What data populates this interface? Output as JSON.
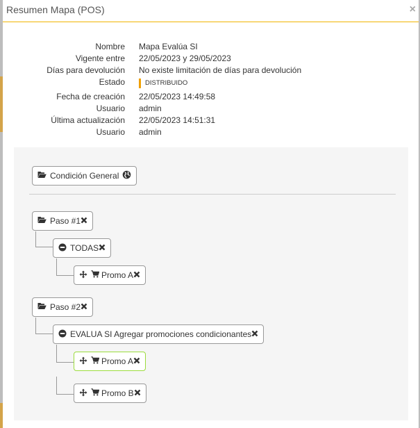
{
  "modal": {
    "title": "Resumen Mapa (POS)",
    "close_glyph": "×"
  },
  "info": {
    "nombre_label": "Nombre",
    "nombre_value": "Mapa Evalúa SI",
    "vigente_label": "Vigente entre",
    "vigente_value": "22/05/2023 y 29/05/2023",
    "dias_label": "Días para devolución",
    "dias_value": "No existe limitación de días para devolución",
    "estado_label": "Estado",
    "estado_value": "DISTRIBUIDO",
    "fecha_label": "Fecha de creación",
    "fecha_value": "22/05/2023 14:49:58",
    "usuario1_label": "Usuario",
    "usuario1_value": "admin",
    "actualizacion_label": "Última actualización",
    "actualizacion_value": "22/05/2023 14:51:31",
    "usuario2_label": "Usuario",
    "usuario2_value": "admin"
  },
  "tree": {
    "general": "Condición General",
    "paso1": "Paso #1",
    "paso1_cond": "TODAS",
    "paso1_promo": "Promo A",
    "paso2": "Paso #2",
    "paso2_cond": "EVALUA SI Agregar promociones condicionantes",
    "paso2_promo_a": "Promo A",
    "paso2_promo_b": "Promo B"
  },
  "colors": {
    "header_border": "#f0b400",
    "estado_bar": "#f0a000",
    "active_node_border": "#9bdc3c"
  },
  "icons": [
    "folder-open-icon",
    "globe-icon",
    "remove-icon",
    "minus-circle-icon",
    "move-icon",
    "cart-icon",
    "close-icon"
  ]
}
